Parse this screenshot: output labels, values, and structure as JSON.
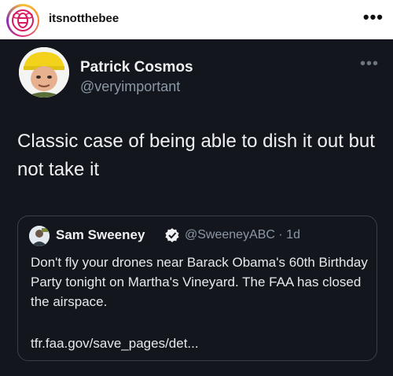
{
  "instagram": {
    "username": "itsnotthebee",
    "more_label": "•••"
  },
  "tweet": {
    "author_name": "Patrick Cosmos",
    "author_handle": "@veryimportant",
    "more_label": "•••",
    "text": "Classic case of being able to dish it out but not take it",
    "quoted": {
      "author_name": "Sam Sweeney",
      "author_handle": "@SweeneyABC · 1d",
      "text": "Don't fly your drones near Barack Obama's 60th Birthday  Party tonight on Martha's Vineyard. The FAA has closed the airspace.",
      "link": "tfr.faa.gov/save_pages/det..."
    }
  },
  "colors": {
    "tweet_bg": "#14161d",
    "verified": "#1d9bf0"
  }
}
